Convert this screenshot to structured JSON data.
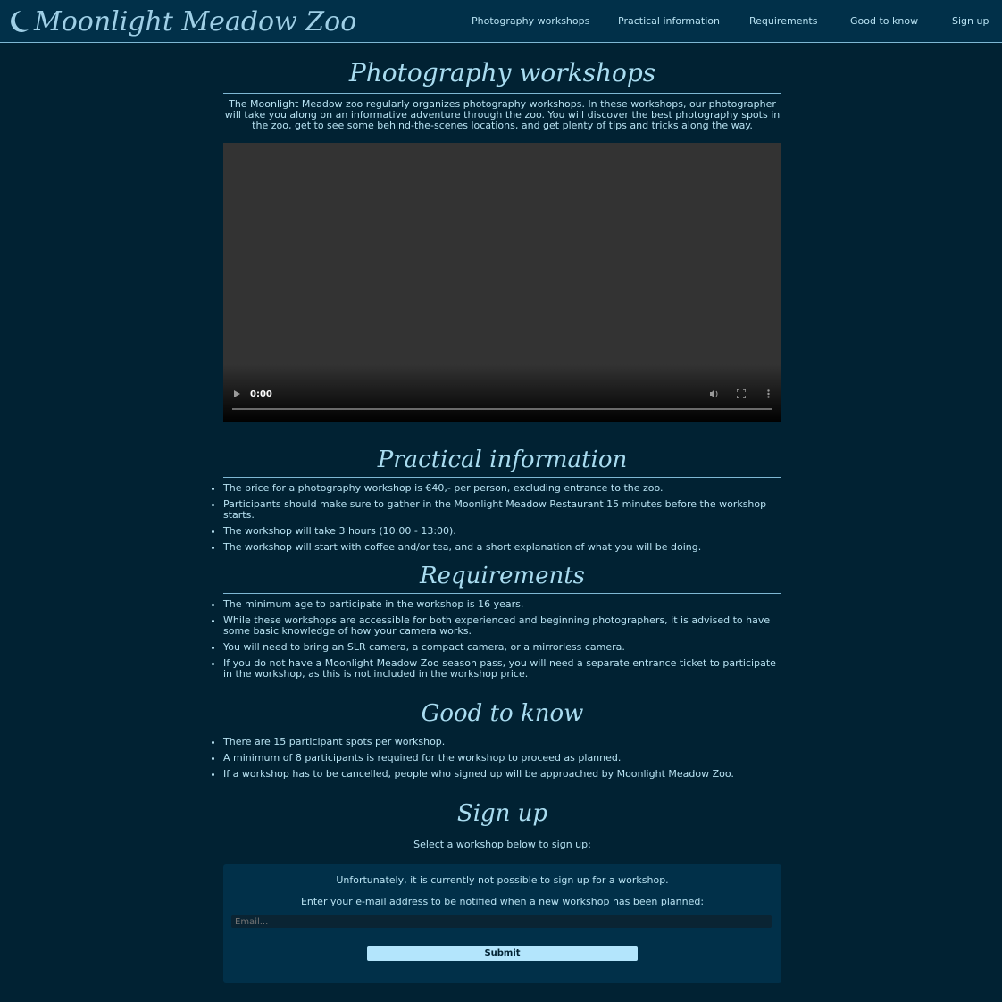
{
  "brand": {
    "name": "Moonlight Meadow Zoo"
  },
  "nav": [
    "Photography workshops",
    "Practical information",
    "Requirements",
    "Good to know",
    "Sign up"
  ],
  "intro": {
    "title": "Photography workshops",
    "text": "The Moonlight Meadow zoo regularly organizes photography workshops. In these workshops, our photographer will take you along on an informative adventure through the zoo. You will discover the best photography spots in the zoo, get to see some behind-the-scenes locations, and get plenty of tips and tricks along the way."
  },
  "video": {
    "time": "0:00"
  },
  "practical": {
    "title": "Practical information",
    "items": [
      "The price for a photography workshop is €40,- per person, excluding entrance to the zoo.",
      "Participants should make sure to gather in the Moonlight Meadow Restaurant 15 minutes before the workshop starts.",
      "The workshop will take 3 hours (10:00 - 13:00).",
      "The workshop will start with coffee and/or tea, and a short explanation of what you will be doing."
    ]
  },
  "requirements": {
    "title": "Requirements",
    "items": [
      "The minimum age to participate in the workshop is 16 years.",
      "While these workshops are accessible for both experienced and beginning photographers, it is advised to have some basic knowledge of how your camera works.",
      "You will need to bring an SLR camera, a compact camera, or a mirrorless camera.",
      "If you do not have a Moonlight Meadow Zoo season pass, you will need a separate entrance ticket to participate in the workshop, as this is not included in the workshop price."
    ]
  },
  "good_to_know": {
    "title": "Good to know",
    "items": [
      "There are 15 participant spots per workshop.",
      "A minimum of 8 participants is required for the workshop to proceed as planned.",
      "If a workshop has to be cancelled, people who signed up will be approached by Moonlight Meadow Zoo."
    ]
  },
  "signup": {
    "title": "Sign up",
    "prompt": "Select a workshop below to sign up:",
    "unavailable": "Unfortunately, it is currently not possible to sign up for a workshop.",
    "notify": "Enter your e-mail address to be notified when a new workshop has been planned:",
    "email_placeholder": "Email...",
    "submit_label": "Submit"
  },
  "icons": {
    "logo": "crescent-moon-icon",
    "play": "play-icon",
    "volume": "volume-icon",
    "fullscreen": "fullscreen-icon",
    "more": "more-vertical-icon"
  },
  "colors": {
    "background": "#012233",
    "header": "#013049",
    "text": "#b8e2f2",
    "accent": "#b3e5fc"
  }
}
